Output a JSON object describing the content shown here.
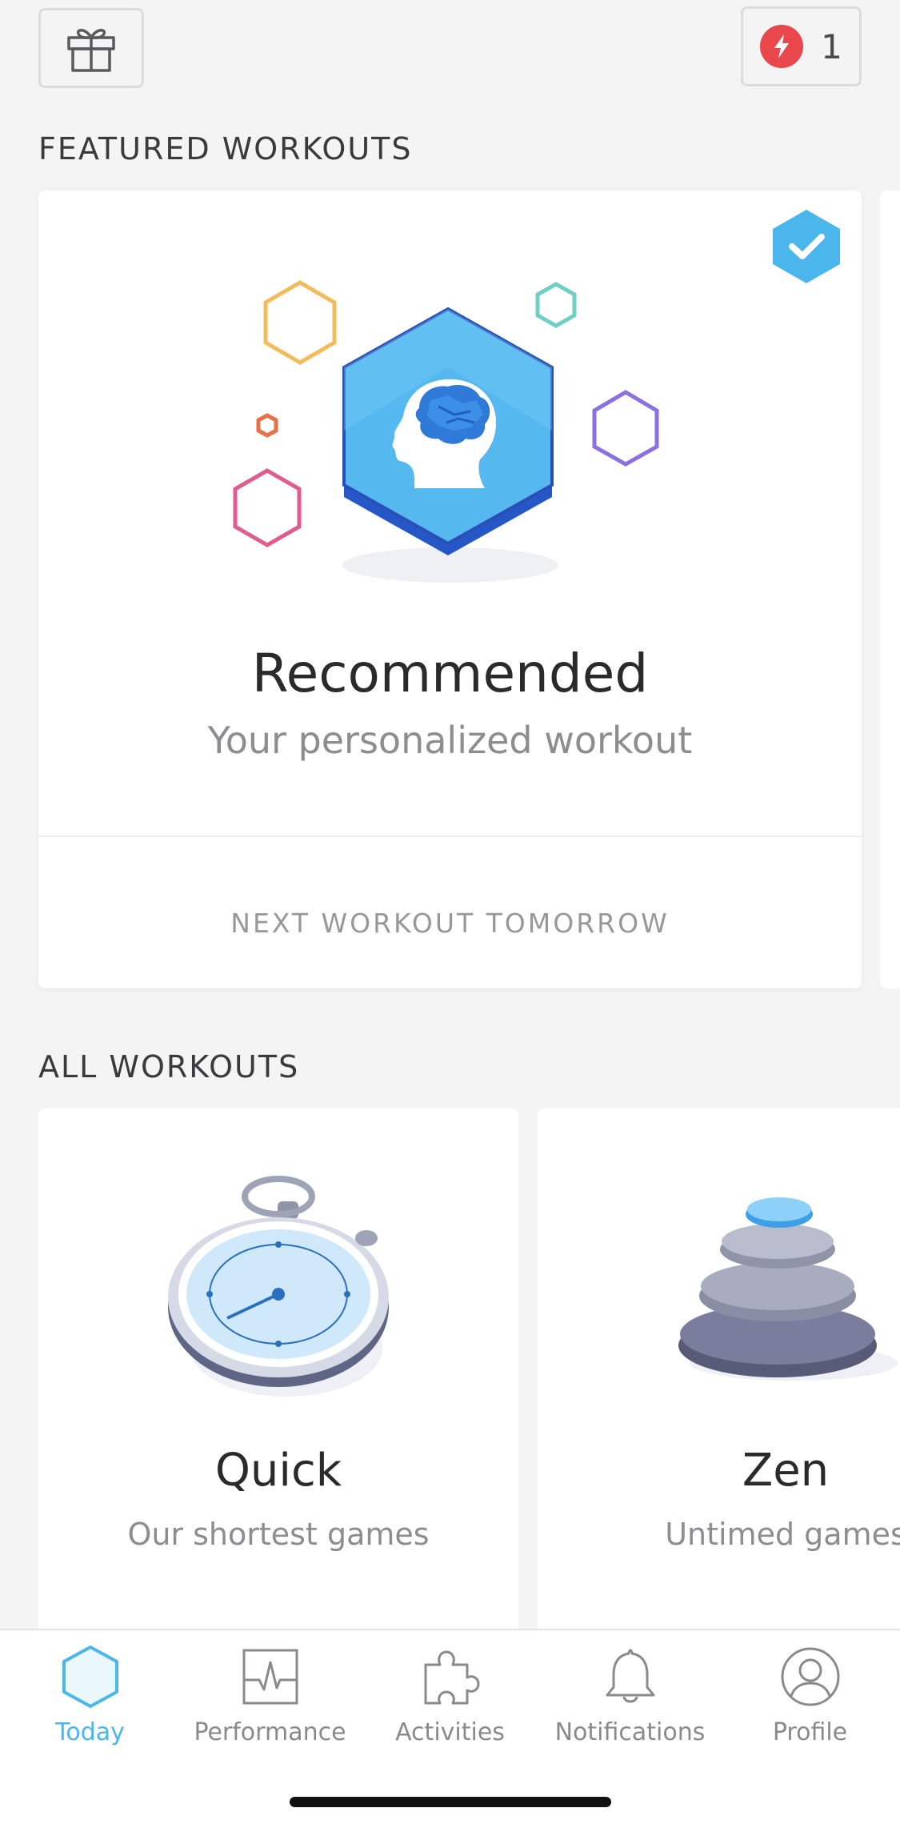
{
  "header": {
    "gift_icon": "gift-icon",
    "energy_icon": "lightning-icon",
    "energy_count": "1"
  },
  "featured": {
    "section_title": "FEATURED WORKOUTS",
    "card": {
      "title": "Recommended",
      "subtitle": "Your personalized workout",
      "footer": "NEXT WORKOUT TOMORROW",
      "completed": true
    }
  },
  "all_workouts": {
    "section_title": "ALL WORKOUTS",
    "cards": [
      {
        "title": "Quick",
        "subtitle": "Our shortest games",
        "icon": "stopwatch-icon"
      },
      {
        "title": "Zen",
        "subtitle": "Untimed games",
        "icon": "stones-icon"
      }
    ]
  },
  "tabbar": {
    "tabs": [
      {
        "label": "Today",
        "icon": "hexagon-icon",
        "active": true
      },
      {
        "label": "Performance",
        "icon": "pulse-chart-icon",
        "active": false
      },
      {
        "label": "Activities",
        "icon": "puzzle-icon",
        "active": false
      },
      {
        "label": "Notifications",
        "icon": "bell-icon",
        "active": false
      },
      {
        "label": "Profile",
        "icon": "profile-icon",
        "active": false
      }
    ]
  },
  "colors": {
    "accent": "#4bb6ec",
    "energy": "#e8474c",
    "background": "#f4f4f5"
  }
}
